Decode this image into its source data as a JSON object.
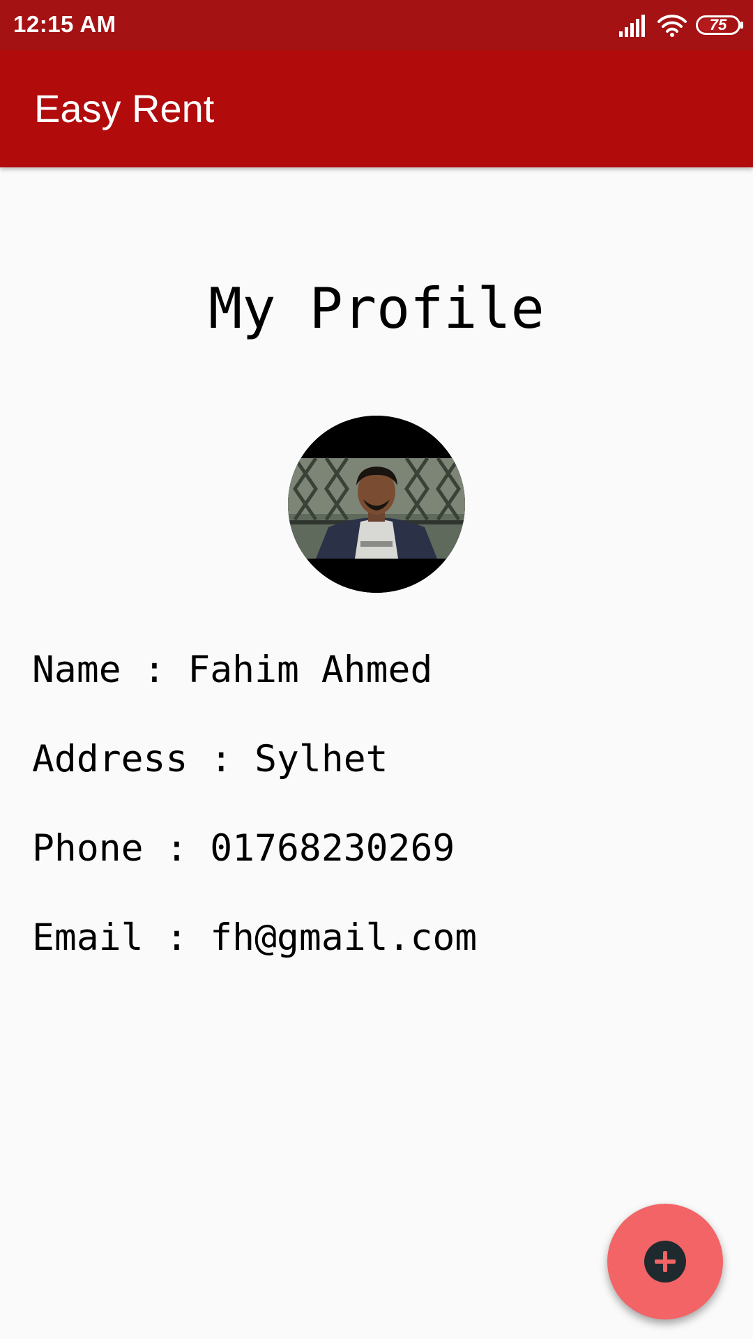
{
  "status_bar": {
    "time": "12:15 AM",
    "battery_level": "75",
    "icons": [
      "signal-icon",
      "wifi-icon",
      "battery-icon"
    ]
  },
  "app_bar": {
    "title": "Easy Rent"
  },
  "profile": {
    "heading": "My Profile",
    "name_line": "Name : Fahim Ahmed",
    "address_line": "Address : Sylhet",
    "phone_line": "Phone : 01768230269",
    "email_line": "Email : fh@gmail.com"
  },
  "fab": {
    "icon": "plus-icon"
  },
  "colors": {
    "status_bar": "#a51214",
    "app_bar": "#b20b0c",
    "background": "#fafafa",
    "fab": "#f26466",
    "fab_icon": "#1e2a2e"
  }
}
